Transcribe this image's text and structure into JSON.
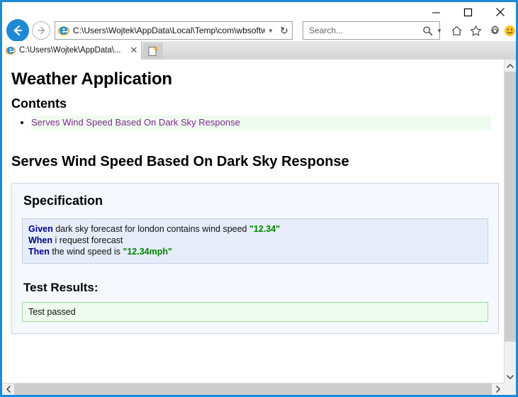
{
  "browser": {
    "name": "internet-explorer",
    "accent_color": "#1e8ad6",
    "caption": {
      "minimize_label": "Minimize",
      "maximize_label": "Maximize",
      "close_label": "Close"
    },
    "address": {
      "url": "C:\\Users\\Wojtek\\AppData\\Local\\Temp\\com\\wbsoftw",
      "dropdown_glyph": "▼",
      "refresh_glyph": "↻"
    },
    "search": {
      "value": "",
      "placeholder": "Search...",
      "caret_glyph": "▼"
    },
    "toolbar_icons": [
      {
        "name": "home-icon",
        "label": "Home"
      },
      {
        "name": "favorites-icon",
        "label": "Favorites"
      },
      {
        "name": "tools-gear-icon",
        "label": "Tools"
      },
      {
        "name": "feedback-smiley-icon",
        "label": "Send feedback"
      }
    ],
    "tab": {
      "title": "C:\\Users\\Wojtek\\AppData\\...",
      "close_glyph": "✕",
      "newtab_label": "New tab"
    }
  },
  "page": {
    "app_title": "Weather Application",
    "contents_title": "Contents",
    "contents_items": [
      {
        "label": "Serves Wind Speed Based On Dark Sky Response"
      }
    ],
    "section_title": "Serves Wind Speed Based On Dark Sky Response",
    "specification": {
      "heading": "Specification",
      "lines": [
        {
          "keyword": "Given",
          "text_before": " dark sky forecast for london contains wind speed ",
          "value": "\"12.34\"",
          "text_after": ""
        },
        {
          "keyword": "When",
          "text_before": " i request forecast",
          "value": "",
          "text_after": ""
        },
        {
          "keyword": "Then",
          "text_before": " the wind speed is ",
          "value": "\"12.34mph\"",
          "text_after": ""
        }
      ],
      "keyword_color": "#00008b",
      "value_color": "#018000"
    },
    "results": {
      "heading": "Test Results:",
      "status_text": "Test passed",
      "status_color": "#eefbee",
      "status_border": "#a3d6a3"
    },
    "link_color": "#7c2a8f",
    "highlight_color": "#f0fbf0"
  },
  "scrollbars": {
    "vertical": {
      "up_glyph": "∧",
      "down_glyph": "∨"
    },
    "horizontal": {
      "left_glyph": "‹",
      "right_glyph": "›"
    }
  }
}
